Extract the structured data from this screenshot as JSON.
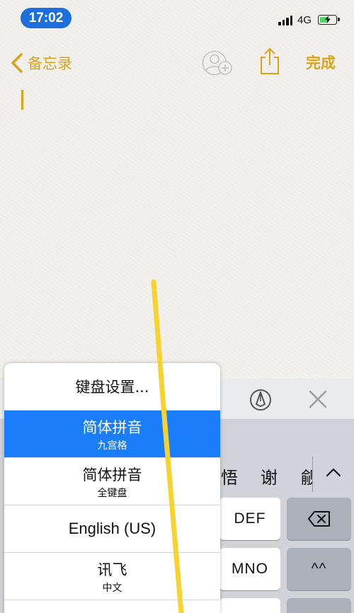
{
  "status_bar": {
    "time": "17:02",
    "network": "4G"
  },
  "nav": {
    "back_label": "备忘录",
    "done_label": "完成"
  },
  "keyboard": {
    "candidates": [
      "悟",
      "谢",
      "觎"
    ],
    "keys": {
      "def": "DEF",
      "mno": "MNO",
      "emoji": "^^"
    }
  },
  "language_menu": {
    "items": [
      {
        "label": "键盘设置..."
      },
      {
        "label": "简体拼音",
        "sub": "九宫格",
        "selected": true
      },
      {
        "label": "简体拼音",
        "sub": "全键盘"
      },
      {
        "label": "English (US)"
      },
      {
        "label": "讯飞",
        "sub": "中文"
      }
    ]
  },
  "colors": {
    "accent": "#d9a41a",
    "selection": "#1a7efb",
    "time_pill": "#1d6fde"
  }
}
